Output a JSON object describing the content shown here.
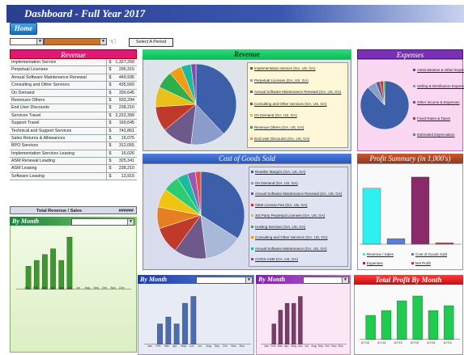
{
  "header": {
    "title": "Dashboard - Full Year 2017",
    "home_label": "Home",
    "period_button": "Select A Period"
  },
  "colors": {
    "accent": "#2b3f8f",
    "revenue_head": "#e0187a",
    "green_head": "#1fd26a",
    "purple_head": "#7a2fb6",
    "cogs_head": "#3a66c8",
    "profit_head": "#b04a3a",
    "red_head": "#e01818"
  },
  "revenue": {
    "title": "Revenue",
    "rows": [
      {
        "label": "Implementation Service",
        "cur": "$",
        "value": "1,327,250"
      },
      {
        "label": "Perpetual Licenses",
        "cur": "$",
        "value": "295,315"
      },
      {
        "label": "Annual Software Maintenance Renewal",
        "cur": "$",
        "value": "449,936"
      },
      {
        "label": "Consulting and Other Services",
        "cur": "$",
        "value": "435,560"
      },
      {
        "label": "On Demand",
        "cur": "$",
        "value": "330,645"
      },
      {
        "label": "Revenues Others",
        "cur": "$",
        "value": "933,294"
      },
      {
        "label": "End User Discounts",
        "cur": "$",
        "value": "238,210"
      },
      {
        "label": "Services Travel",
        "cur": "$",
        "value": "2,222,399"
      },
      {
        "label": "Support Travel",
        "cur": "$",
        "value": "160,645"
      },
      {
        "label": "Technical and Support Services",
        "cur": "$",
        "value": "742,861"
      },
      {
        "label": "Sales Returns & Allowances",
        "cur": "$",
        "value": "16,075"
      },
      {
        "label": "BPO Services",
        "cur": "$",
        "value": "312,055"
      },
      {
        "label": "Implementation Services Leasing",
        "cur": "$",
        "value": "16,026"
      },
      {
        "label": "ASM Renewal Leading",
        "cur": "$",
        "value": "325,341"
      },
      {
        "label": "ASM Leasing",
        "cur": "$",
        "value": "238,210"
      },
      {
        "label": "Software Leasing",
        "cur": "$",
        "value": "13,915"
      }
    ],
    "total_label": "Total Revenue / Sales",
    "total_value": "######"
  },
  "revenue_chart": {
    "title": "Revenue",
    "legend": [
      "Implementation Service (GA, US, GA)",
      "Perpetual Licenses (GA, US, GA)",
      "Annual Software Maintenance Renewal (GA, US, GA)",
      "Consulting and Other Services (GA, US, GA)",
      "On Demand (GA, US, GA)",
      "Revenue Others (GA, US, GA)",
      "End User Discounts (GA, US, GA)"
    ]
  },
  "expenses": {
    "title": "Expenses",
    "legend": [
      "Administrative & Other Expenses",
      "Selling & Distribution Expenses",
      "Other Income & Expenses",
      "Fixed Rates & Taxes",
      "Estimated Depreciation"
    ]
  },
  "cogs": {
    "title": "Cost of Goods Sold",
    "legend": [
      "Reseller Margins (GA, US, GA)",
      "On Demand (GA, US, GA)",
      "Annual Software Maintenance Renewal (GA, US, GA)",
      "OEM License Fee (GA, US, GA)",
      "3rd Party Perpetual Licenses (GA, US, GA)",
      "Hosting Services (GA, US, GA)",
      "Consulting and Other Services (GA, US, GA)",
      "Annual Software Maintenance (GA, US, GA)",
      "COGS-ASM (GA, US, GA)"
    ]
  },
  "profit_summary": {
    "title": "Profit Summary (in 1,000's)",
    "legend": [
      "Revenue / Sales",
      "Cost of Goods Sold",
      "Expenses",
      "Net Profit"
    ]
  },
  "month_labels": [
    "Jan",
    "Feb",
    "Mar",
    "Apr",
    "May",
    "Jun",
    "Jul",
    "Aug",
    "Sep",
    "Oct",
    "Nov",
    "Dec"
  ],
  "by_month_label": "By Month",
  "total_profit": {
    "title": "Total Profit By Month",
    "ticks": [
      "6/7/16",
      "6/7/16",
      "6/7/16",
      "6/7/16",
      "6/7/16",
      "6/7/16"
    ]
  },
  "chart_data": [
    {
      "type": "pie",
      "title": "Revenue",
      "values": [
        38,
        14,
        12,
        10,
        8,
        7,
        5,
        4,
        2
      ]
    },
    {
      "type": "pie",
      "title": "Expenses",
      "values": [
        88,
        6,
        3,
        2,
        1
      ]
    },
    {
      "type": "pie",
      "title": "Cost of Goods Sold",
      "values": [
        34,
        14,
        12,
        10,
        8,
        7,
        6,
        4,
        3,
        2
      ]
    },
    {
      "type": "bar",
      "title": "Profit Summary (in 1,000's)",
      "categories": [
        "Revenue / Sales",
        "Cost of Goods Sold",
        "Expenses",
        "Net Profit"
      ],
      "values": [
        1000,
        100,
        1200,
        25
      ]
    },
    {
      "type": "bar",
      "title": "By Month",
      "values": [
        4,
        5,
        6,
        7,
        5,
        9,
        0,
        0,
        0,
        0,
        0,
        0
      ]
    },
    {
      "type": "bar",
      "title": "By Month",
      "values": [
        0,
        3,
        4,
        3,
        6,
        7,
        0,
        0,
        0,
        0,
        0,
        0
      ]
    },
    {
      "type": "bar",
      "title": "By Month",
      "values": [
        0,
        3,
        5,
        6,
        6,
        7,
        0,
        0,
        0,
        0,
        0,
        0
      ]
    },
    {
      "type": "bar",
      "title": "Total Profit By Month",
      "values": [
        5,
        6,
        8,
        9,
        6,
        7
      ]
    }
  ]
}
